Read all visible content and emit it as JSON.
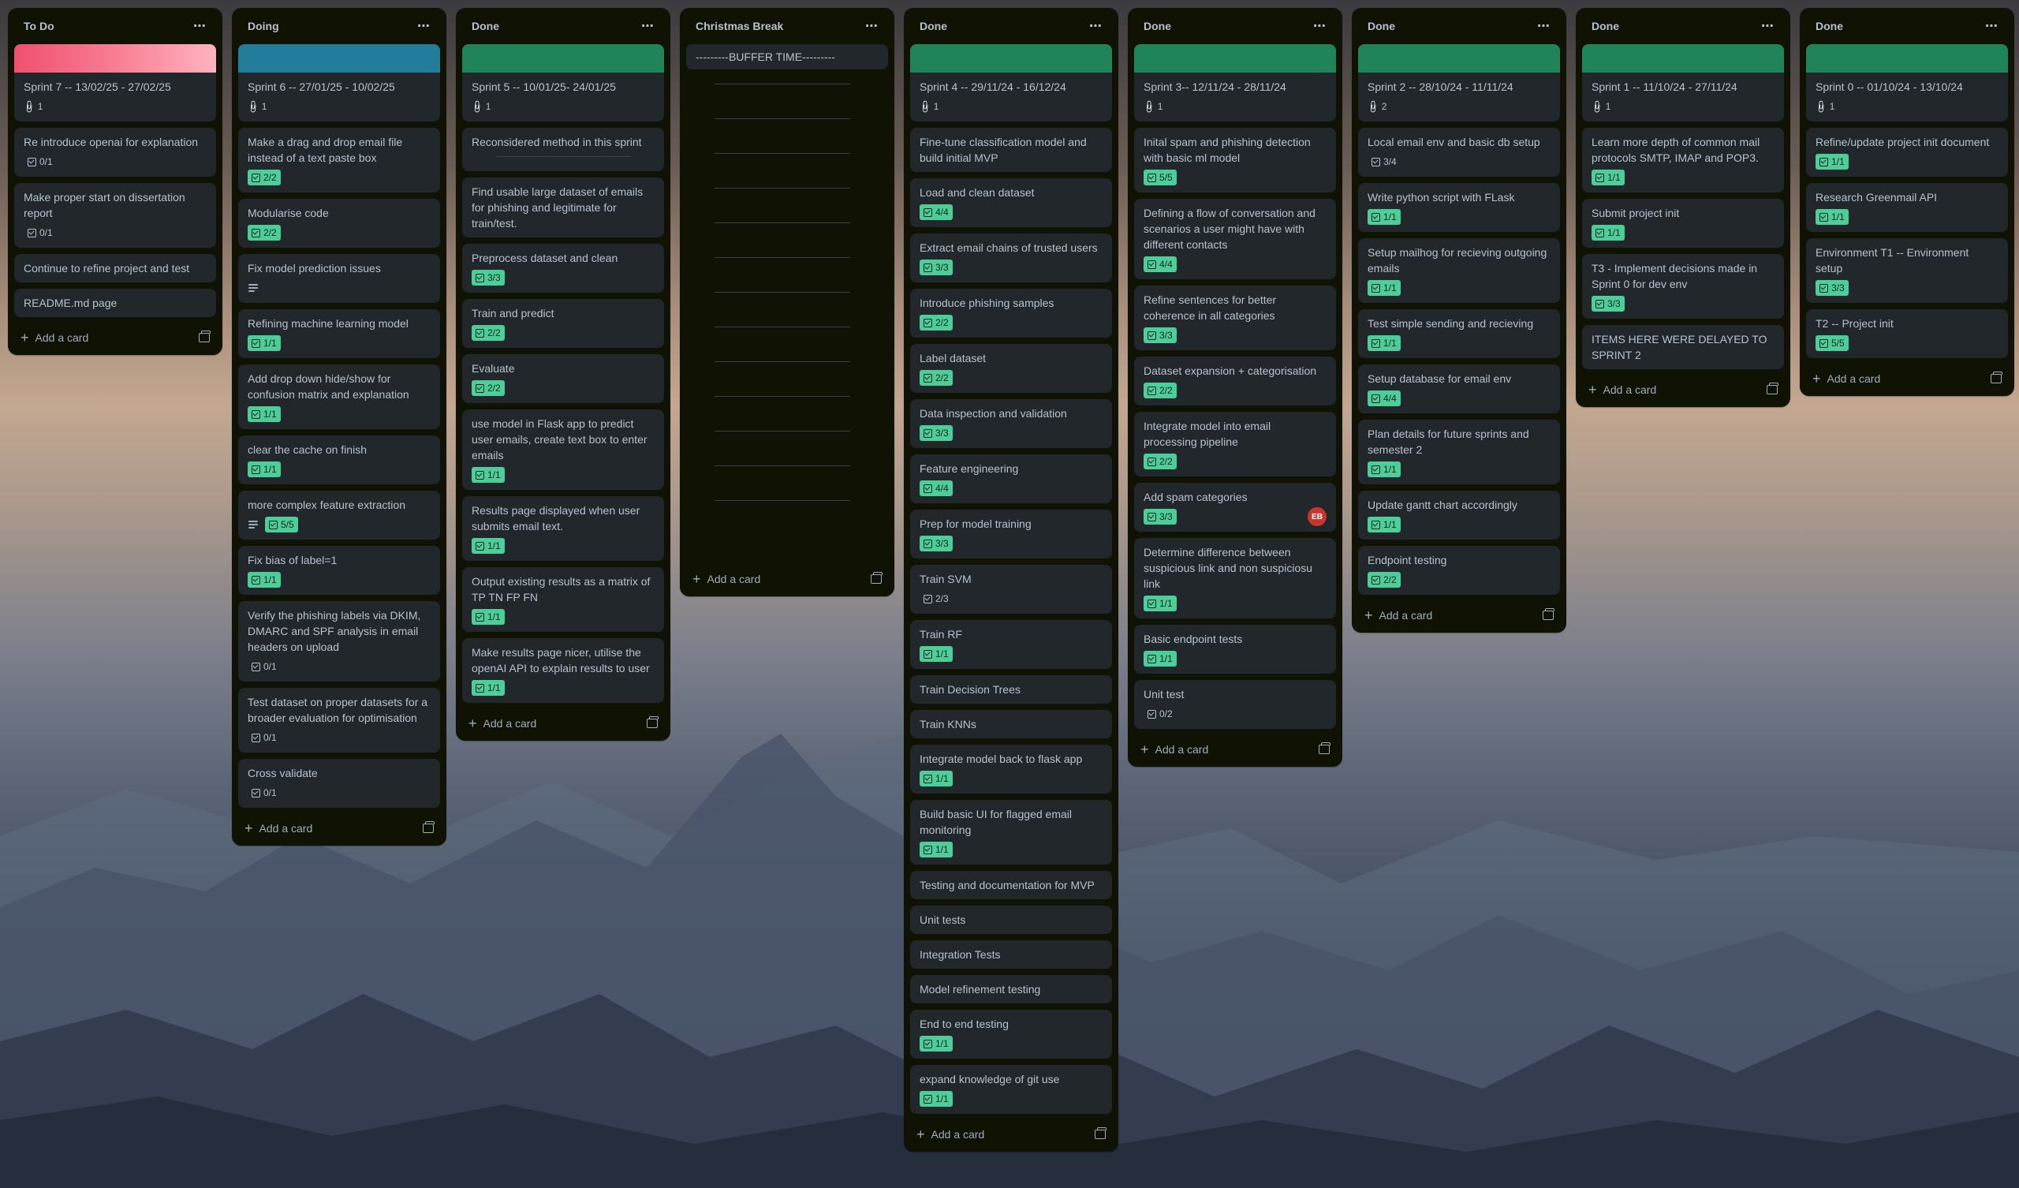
{
  "board": {
    "lists": [
      {
        "title": "To Do",
        "cards": [
          {
            "title": "Sprint 7 -- 13/02/25 - 27/02/25",
            "cover": "#f87168",
            "attachments": "1"
          },
          {
            "title": "Re introduce openai for explanation",
            "checklist": "0/1",
            "done": false
          },
          {
            "title": "Make proper start on dissertation report",
            "checklist": "0/1",
            "done": false
          },
          {
            "title": "Continue to refine project and test"
          },
          {
            "title": "README.md page"
          }
        ],
        "add_label": "Add a card"
      },
      {
        "title": "Doing",
        "cards": [
          {
            "title": "Sprint 6 -- 27/01/25 - 10/02/25",
            "cover": "#227d9b",
            "attachments": "1"
          },
          {
            "title": "Make a drag and drop email file instead of a text paste box",
            "checklist": "2/2",
            "done": true
          },
          {
            "title": "Modularise code",
            "checklist": "2/2",
            "done": true
          },
          {
            "title": "Fix model prediction issues",
            "description": true
          },
          {
            "title": "Refining machine learning model",
            "checklist": "1/1",
            "done": true
          },
          {
            "title": "Add drop down hide/show for confusion matrix and explanation",
            "checklist": "1/1",
            "done": true
          },
          {
            "title": "clear the cache on finish",
            "checklist": "1/1",
            "done": true
          },
          {
            "title": "more complex feature extraction",
            "checklist": "5/5",
            "done": true,
            "description": true
          },
          {
            "title": "Fix bias of label=1",
            "checklist": "1/1",
            "done": true
          },
          {
            "title": "Verify the phishing labels via DKIM, DMARC and SPF analysis in email headers on upload",
            "checklist": "0/1",
            "done": false
          },
          {
            "title": "Test dataset on proper datasets for a broader evaluation for optimisation",
            "checklist": "0/1",
            "done": false
          },
          {
            "title": "Cross validate",
            "checklist": "0/1",
            "done": false
          }
        ],
        "add_label": "Add a card"
      },
      {
        "title": "Done",
        "cards": [
          {
            "title": "Sprint 5 -- 10/01/25- 24/01/25",
            "cover": "#1f845a",
            "attachments": "1"
          },
          {
            "title": "Reconsidered method in this sprint",
            "separator": true
          },
          {
            "title": "Find usable large dataset of emails for phishing and legitimate for train/test."
          },
          {
            "title": "Preprocess dataset and clean",
            "checklist": "3/3",
            "done": true
          },
          {
            "title": "Train and predict",
            "checklist": "2/2",
            "done": true
          },
          {
            "title": "Evaluate",
            "checklist": "2/2",
            "done": true
          },
          {
            "title": "use model in Flask app to predict user emails, create text box to enter emails",
            "checklist": "1/1",
            "done": true
          },
          {
            "title": "Results page displayed when user submits email text.",
            "checklist": "1/1",
            "done": true
          },
          {
            "title": "Output existing results as a matrix of TP TN FP FN",
            "checklist": "1/1",
            "done": true
          },
          {
            "title": "Make results page nicer, utilise the openAI API to explain results to user",
            "checklist": "1/1",
            "done": true
          }
        ],
        "add_label": "Add a card"
      },
      {
        "title": "Christmas Break",
        "cards": [
          {
            "title": "---------BUFFER TIME---------",
            "buffer": true
          }
        ],
        "add_label": "Add a card"
      },
      {
        "title": "Done",
        "cards": [
          {
            "title": "Sprint 4 -- 29/11/24 - 16/12/24",
            "cover": "#1f845a",
            "attachments": "1"
          },
          {
            "title": "Fine-tune classification model and build initial MVP"
          },
          {
            "title": "Load and clean dataset",
            "checklist": "4/4",
            "done": true
          },
          {
            "title": "Extract email chains of trusted users",
            "checklist": "3/3",
            "done": true
          },
          {
            "title": "Introduce phishing samples",
            "checklist": "2/2",
            "done": true
          },
          {
            "title": "Label dataset",
            "checklist": "2/2",
            "done": true
          },
          {
            "title": "Data inspection and validation",
            "checklist": "3/3",
            "done": true
          },
          {
            "title": "Feature engineering",
            "checklist": "4/4",
            "done": true
          },
          {
            "title": "Prep for model training",
            "checklist": "3/3",
            "done": true
          },
          {
            "title": "Train SVM",
            "checklist": "2/3",
            "done": false
          },
          {
            "title": "Train RF",
            "checklist": "1/1",
            "done": true
          },
          {
            "title": "Train Decision Trees"
          },
          {
            "title": "Train KNNs"
          },
          {
            "title": "Integrate model back to flask app",
            "checklist": "1/1",
            "done": true
          },
          {
            "title": "Build basic UI for flagged email monitoring",
            "checklist": "1/1",
            "done": true
          },
          {
            "title": "Testing and documentation for MVP"
          },
          {
            "title": "Unit tests"
          },
          {
            "title": "Integration Tests"
          },
          {
            "title": "Model refinement testing"
          },
          {
            "title": "End to end testing",
            "checklist": "1/1",
            "done": true
          },
          {
            "title": "expand knowledge of git use",
            "checklist": "1/1",
            "done": true
          }
        ],
        "add_label": "Add a card"
      },
      {
        "title": "Done",
        "cards": [
          {
            "title": "Sprint 3-- 12/11/24 - 28/11/24",
            "cover": "#1f845a",
            "attachments": "1"
          },
          {
            "title": "Inital spam and phishing detection with basic ml model",
            "checklist": "5/5",
            "done": true
          },
          {
            "title": "Defining a flow of conversation and scenarios a user might have with different contacts",
            "checklist": "4/4",
            "done": true
          },
          {
            "title": "Refine sentences for better coherence in all categories",
            "checklist": "3/3",
            "done": true
          },
          {
            "title": "Dataset expansion + categorisation",
            "checklist": "2/2",
            "done": true
          },
          {
            "title": "Integrate model into email processing pipeline",
            "checklist": "2/2",
            "done": true
          },
          {
            "title": "Add spam categories",
            "checklist": "3/3",
            "done": true,
            "avatar": "EB"
          },
          {
            "title": "Determine difference between suspicious link and non suspiciosu link",
            "checklist": "1/1",
            "done": true
          },
          {
            "title": "Basic endpoint tests",
            "checklist": "1/1",
            "done": true
          },
          {
            "title": "Unit test",
            "checklist": "0/2",
            "done": false
          }
        ],
        "add_label": "Add a card"
      },
      {
        "title": "Done",
        "cards": [
          {
            "title": "Sprint 2 -- 28/10/24 - 11/11/24",
            "cover": "#1f845a",
            "attachments": "2"
          },
          {
            "title": "Local email env and basic db setup",
            "checklist": "3/4",
            "done": false
          },
          {
            "title": "Write python script with FLask",
            "checklist": "1/1",
            "done": true
          },
          {
            "title": "Setup mailhog for recieving outgoing emails",
            "checklist": "1/1",
            "done": true
          },
          {
            "title": "Test simple sending and recieving",
            "checklist": "1/1",
            "done": true
          },
          {
            "title": "Setup database for email env",
            "checklist": "4/4",
            "done": true
          },
          {
            "title": "Plan details for future sprints and semester 2",
            "checklist": "1/1",
            "done": true
          },
          {
            "title": "Update gantt chart accordingly",
            "checklist": "1/1",
            "done": true
          },
          {
            "title": "Endpoint testing",
            "checklist": "2/2",
            "done": true
          }
        ],
        "add_label": "Add a card"
      },
      {
        "title": "Done",
        "cards": [
          {
            "title": "Sprint 1 -- 11/10/24 - 27/11/24",
            "cover": "#1f845a",
            "attachments": "1"
          },
          {
            "title": "Learn more depth of common mail protocols SMTP, IMAP and POP3.",
            "checklist": "1/1",
            "done": true
          },
          {
            "title": "Submit project init",
            "checklist": "1/1",
            "done": true
          },
          {
            "title": "T3 - Implement decisions made in Sprint 0 for dev env",
            "checklist": "3/3",
            "done": true
          },
          {
            "title": "ITEMS HERE WERE DELAYED TO SPRINT 2"
          }
        ],
        "add_label": "Add a card"
      },
      {
        "title": "Done",
        "cards": [
          {
            "title": "Sprint 0 -- 01/10/24 - 13/10/24",
            "cover": "#1f845a",
            "attachments": "1"
          },
          {
            "title": "Refine/update project init document",
            "checklist": "1/1",
            "done": true
          },
          {
            "title": "Research Greenmail API",
            "checklist": "1/1",
            "done": true
          },
          {
            "title": "Environment T1 -- Environment setup",
            "checklist": "3/3",
            "done": true
          },
          {
            "title": "T2 -- Project init",
            "checklist": "5/5",
            "done": true
          }
        ],
        "add_label": "Add a card"
      }
    ]
  }
}
